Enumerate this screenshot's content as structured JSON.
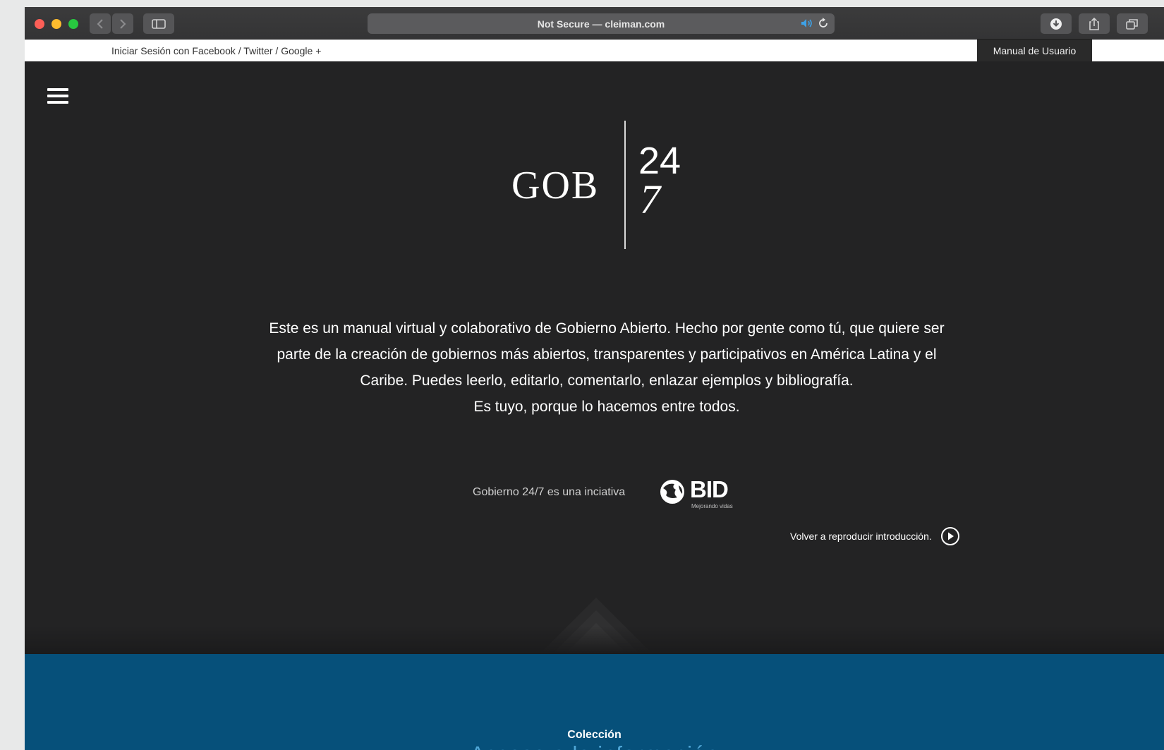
{
  "browser": {
    "address_text": "Not Secure — cleiman.com",
    "icons": [
      "close-icon",
      "minimize-icon",
      "zoom-icon",
      "back-icon",
      "forward-icon",
      "sidebar-icon",
      "speaker-icon",
      "reload-icon",
      "download-icon",
      "share-icon",
      "tabs-icon"
    ]
  },
  "topbar": {
    "login_links": "Iniciar Sesión con Facebook / Twitter / Google +",
    "manual_label": "Manual de Usuario"
  },
  "hero": {
    "logo": {
      "left": "GOB",
      "top_number": "24",
      "bottom_number": "7"
    },
    "intro_lines": [
      "Este es un manual virtual y colaborativo de Gobierno Abierto. Hecho por gente como tú, que quiere ser",
      "parte de la creación de gobiernos más abiertos, transparentes y participativos en América Latina y el",
      "Caribe. Puedes leerlo, editarlo, comentarlo, enlazar ejemplos y bibliografía.",
      "Es tuyo, porque lo hacemos entre todos."
    ],
    "initiative_text": "Gobierno 24/7 es una inciativa",
    "bid_logo": {
      "word": "BID",
      "tagline": "Mejorando vidas"
    },
    "replay_label": "Volver a reproducir introducción."
  },
  "collection": {
    "eyebrow": "Colección",
    "title": "Acceso a la información"
  },
  "colors": {
    "hero_bg": "#232324",
    "collection_bg": "#06507a",
    "collection_title": "#4fa6d6",
    "toolbar_bg": "#3b3b3c"
  }
}
